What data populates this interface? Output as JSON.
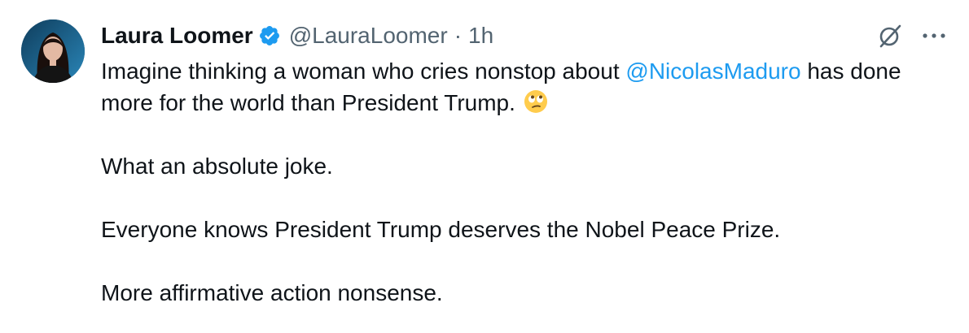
{
  "author": {
    "name": "Laura Loomer",
    "handle": "@LauraLoomer",
    "separator": "·",
    "time": "1h",
    "verified": true,
    "verified_color": "#1d9bf0"
  },
  "actions": {
    "grok_icon": "grok-icon",
    "more_icon": "more-options-icon"
  },
  "tweet": {
    "line1_pre": "Imagine thinking a woman who cries nonstop about ",
    "mention": "@NicolasMaduro",
    "line1_post": " has done more for the world than President Trump.",
    "emoji": "face-with-rolling-eyes-emoji",
    "paragraph2": "What an absolute joke.",
    "paragraph3": "Everyone knows President Trump deserves the Nobel Peace Prize.",
    "paragraph4": "More affirmative action nonsense.",
    "mention_color": "#1d9bf0"
  }
}
